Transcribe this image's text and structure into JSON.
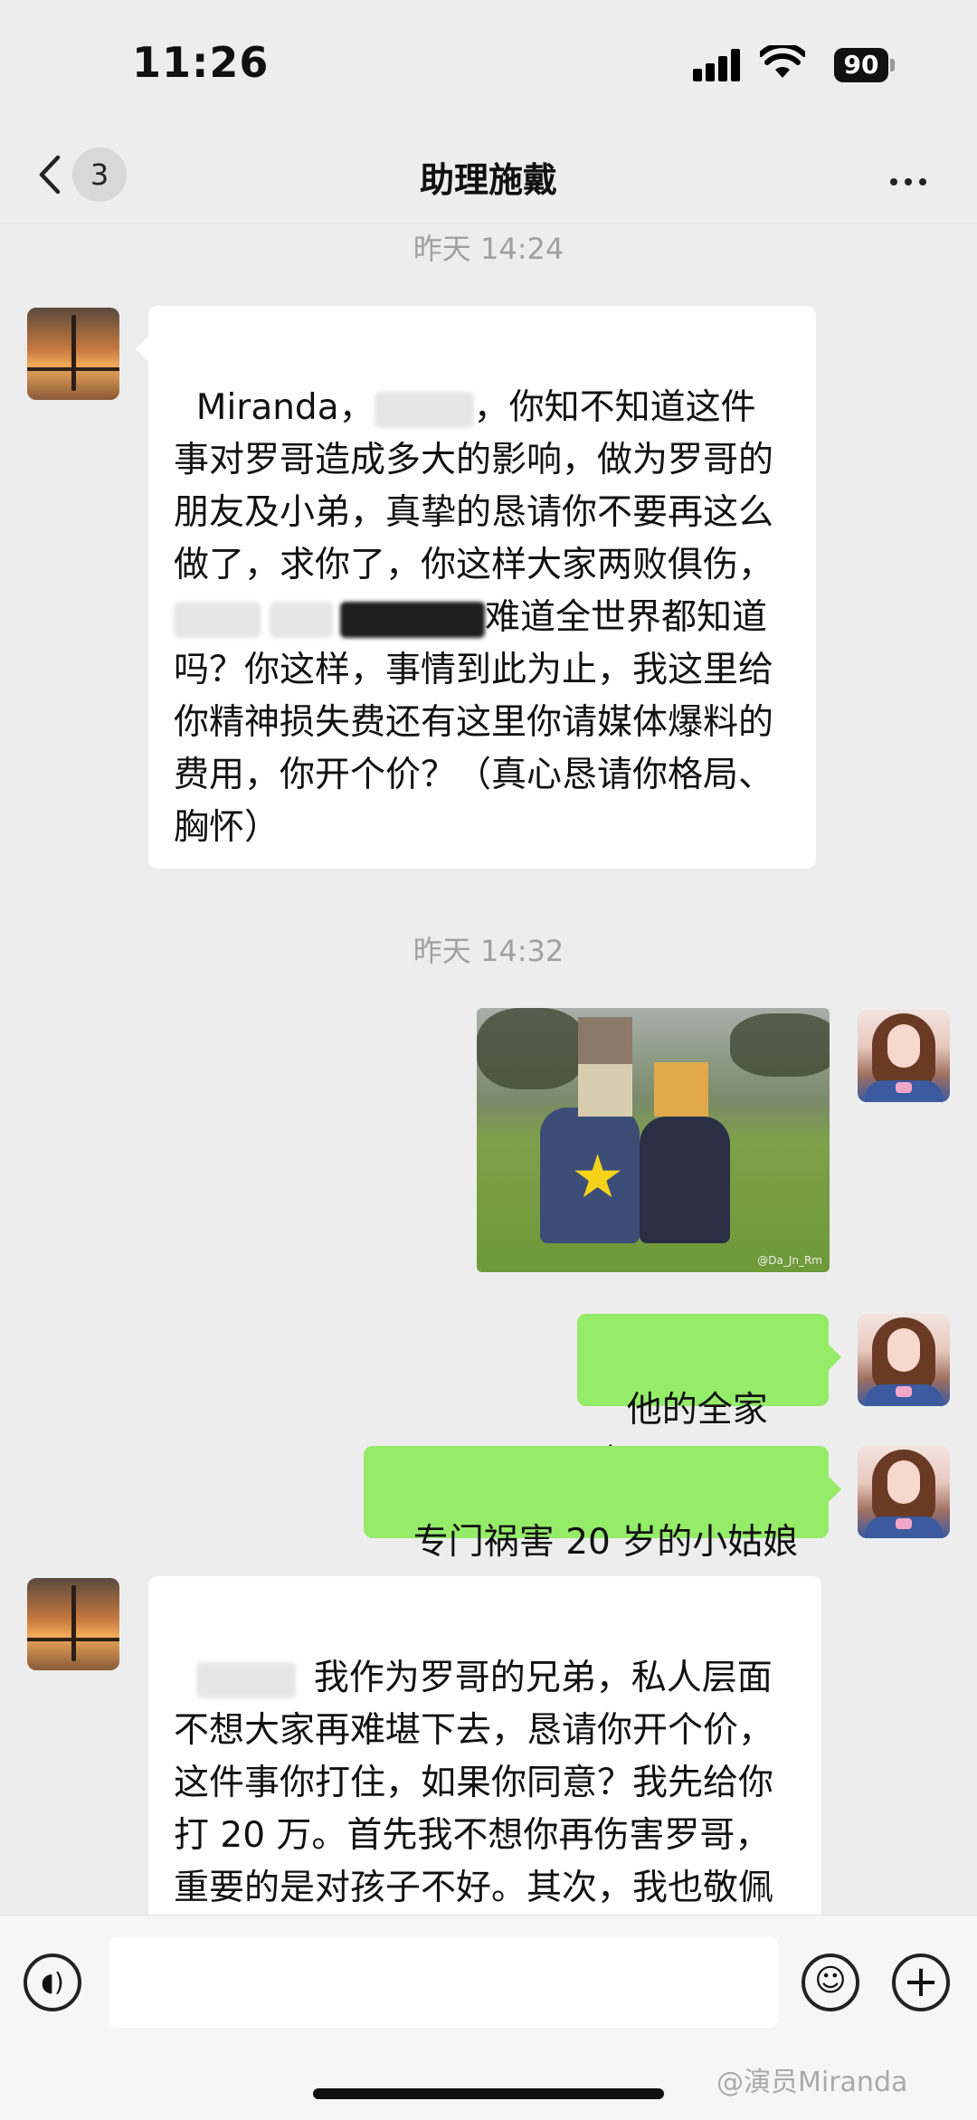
{
  "status": {
    "time": "11:26",
    "battery": "90"
  },
  "nav": {
    "badge": "3",
    "title": "助理施戴"
  },
  "messages": {
    "ts1": "昨天 14:24",
    "m1_a": "Miranda，",
    "m1_b": "，你知不知道这件事对罗哥造成多大的影响，做为罗哥的朋友及小弟，真挚的恳请你不要再这么做了，求你了，你这样大家两败俱伤，",
    "m1_c": "难道全世界都知道吗？你这样，事情到此为止，我这里给你精神损失费还有这里你请媒体爆料的费用，你开个价？（真心恳请你格局、胸怀）",
    "ts2": "昨天 14:32",
    "photo_watermark": "@Da_Jn_Rm",
    "m3": "他的全家福",
    "m4": "专门祸害 20 岁的小姑娘",
    "m5_a": "我作为罗哥的兄弟，私人层面不想大家再难堪下去，恳请你开个价，这件事你打住，如果你同意？我先给你打 20 万。首先我不想你再伤害罗哥，重要的是对孩子不好。其次，我也敬佩你，"
  },
  "watermark": "@演员Miranda",
  "icons": [
    "back-chevron-icon",
    "more-icon",
    "voice-icon",
    "emoji-icon",
    "plus-icon",
    "signal-icon",
    "wifi-icon",
    "battery-icon"
  ]
}
